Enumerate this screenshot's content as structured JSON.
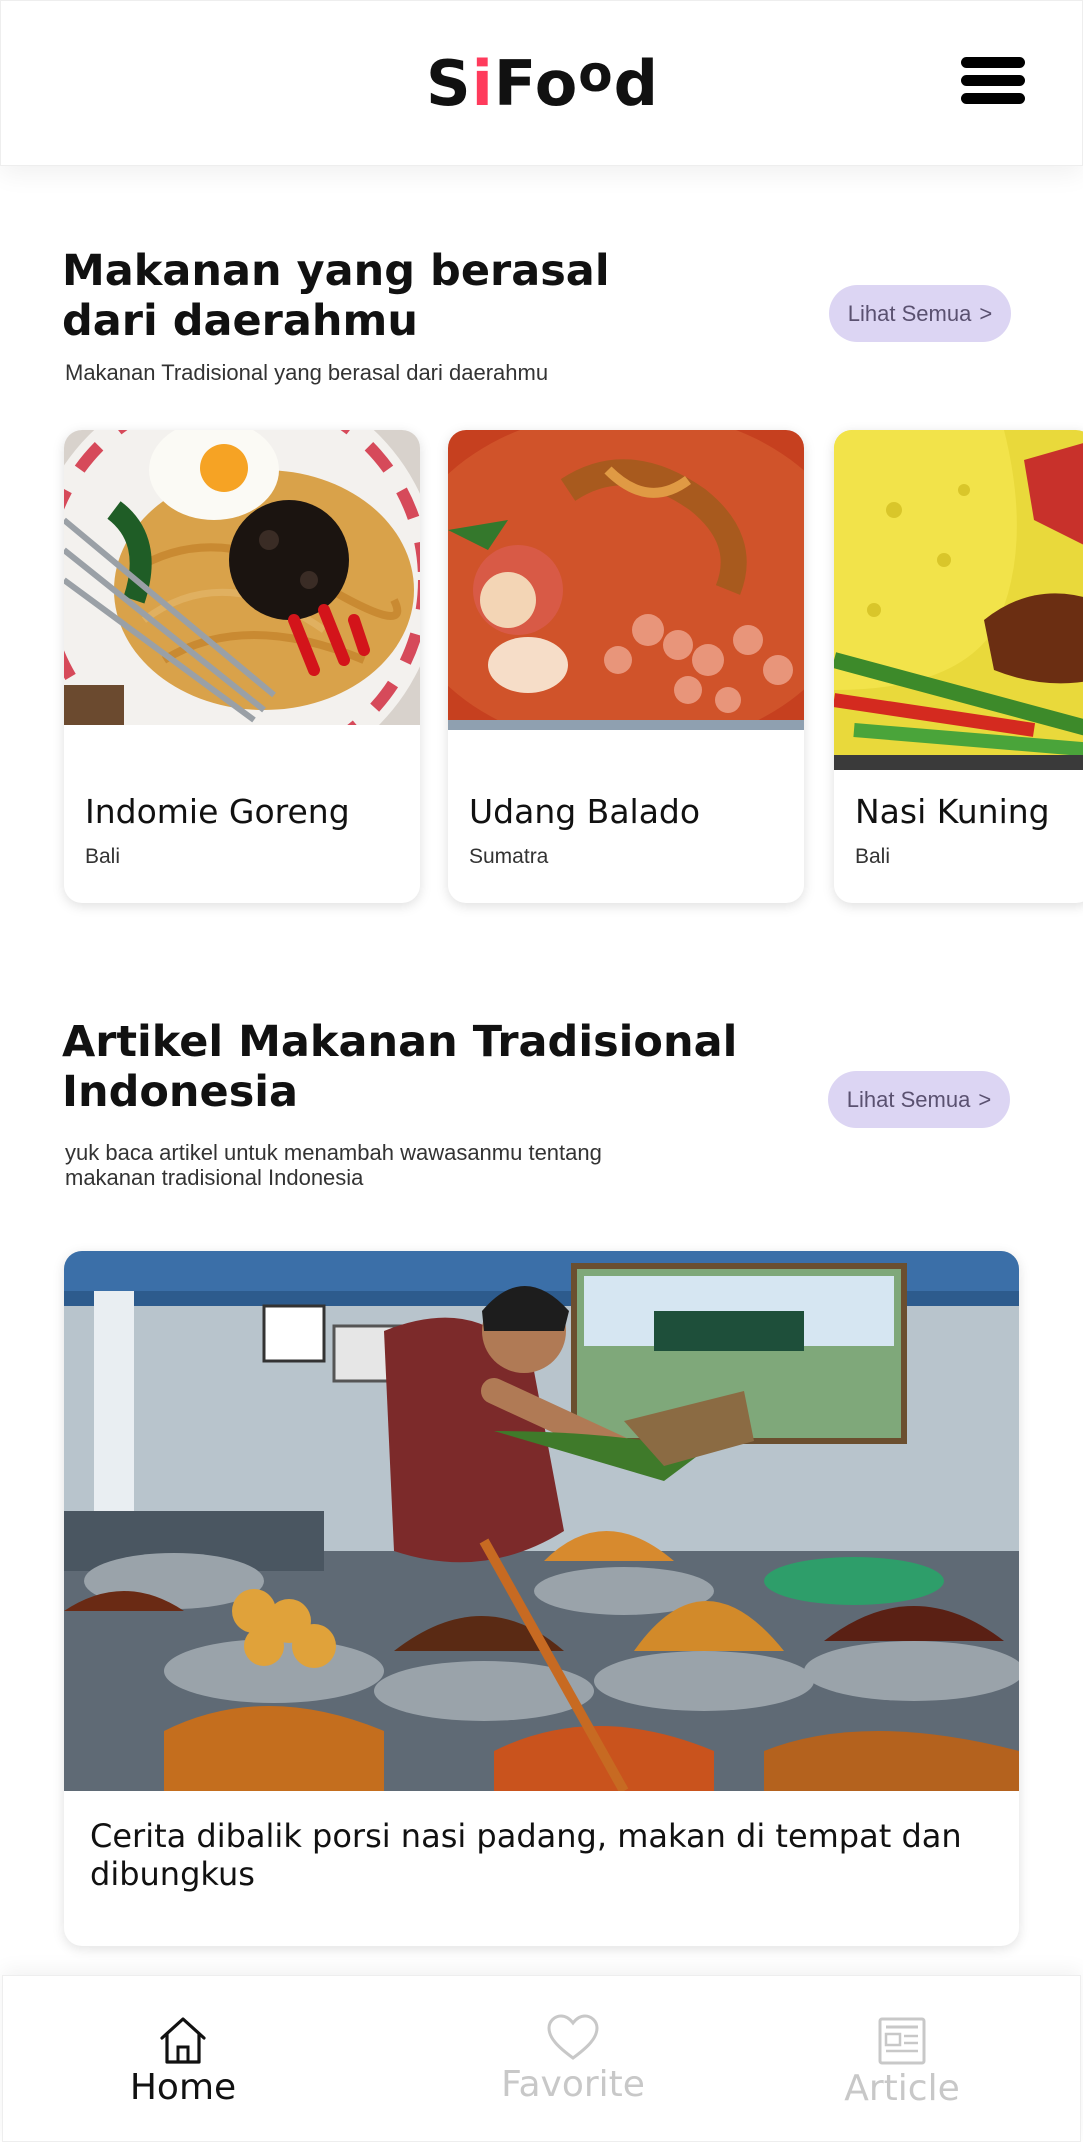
{
  "header": {
    "logo": {
      "part1": "S",
      "dot": "i",
      "part2": "Fo",
      "raised": "o",
      "part3": "d"
    },
    "menu_icon": "hamburger-icon",
    "colors": {
      "logo_dot": "#ff3b5c"
    }
  },
  "regional_section": {
    "title": "Makanan yang berasal dari daerahmu",
    "subtitle": "Makanan Tradisional yang berasal dari daerahmu",
    "see_all": "Lihat Semua",
    "see_all_chevron": ">",
    "foods": [
      {
        "name": "Indomie Goreng",
        "region": "Bali"
      },
      {
        "name": "Udang Balado",
        "region": "Sumatra"
      },
      {
        "name": "Nasi Kuning",
        "region": "Bali"
      }
    ]
  },
  "article_section": {
    "title": "Artikel Makanan Tradisional Indonesia",
    "subtitle": "yuk baca artikel untuk menambah wawasanmu tentang makanan tradisional Indonesia",
    "see_all": "Lihat Semua",
    "see_all_chevron": ">",
    "articles": [
      {
        "title": "Cerita dibalik porsi nasi padang, makan di tempat dan dibungkus"
      }
    ]
  },
  "bottom_nav": {
    "items": [
      {
        "label": "Home",
        "icon": "home-icon",
        "active": true
      },
      {
        "label": "Favorite",
        "icon": "heart-icon",
        "active": false
      },
      {
        "label": "Article",
        "icon": "article-icon",
        "active": false
      }
    ],
    "colors": {
      "active": "#111111",
      "inactive": "#c8c8c8"
    }
  },
  "colors": {
    "accent_pill": "#dcd5f3",
    "pill_text": "#5a5170"
  }
}
